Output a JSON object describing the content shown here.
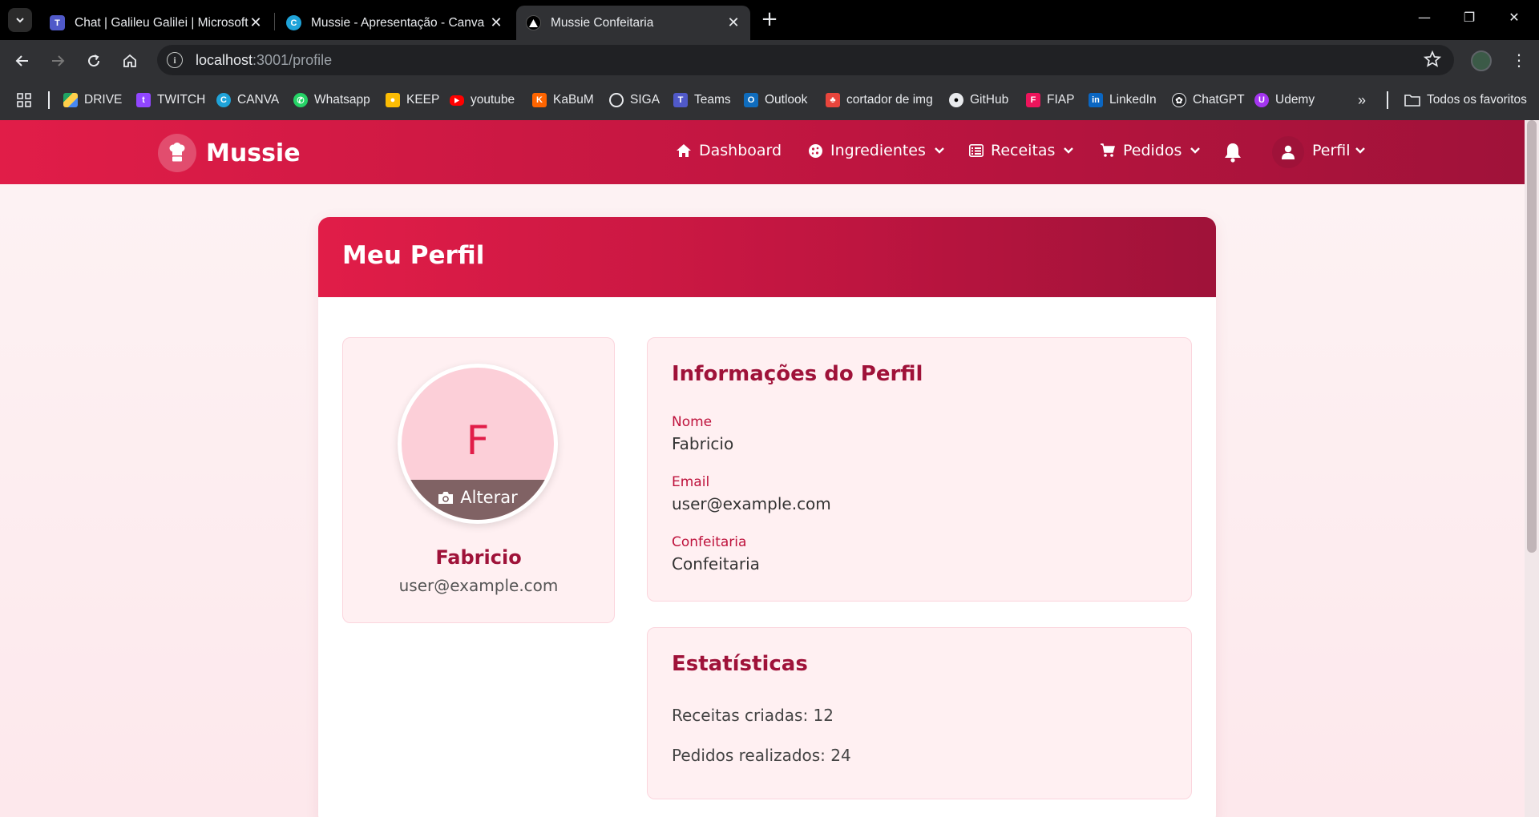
{
  "browser": {
    "tabs": [
      {
        "title": "Chat | Galileu Galilei | Microsoft Teams",
        "icon": "teams-icon"
      },
      {
        "title": "Mussie - Apresentação - Canva",
        "icon": "canva-icon"
      },
      {
        "title": "Mussie Confeitaria",
        "icon": "vercel-icon"
      }
    ],
    "url_host": "localhost",
    "url_path": ":3001/profile",
    "bookmarks": [
      "DRIVE",
      "TWITCH",
      "CANVA",
      "Whatsapp",
      "KEEP",
      "youtube",
      "KaBuM",
      "SIGA",
      "Teams",
      "Outlook",
      "cortador de img",
      "GitHub",
      "FIAP",
      "LinkedIn",
      "ChatGPT",
      "Udemy"
    ],
    "all_bookmarks": "Todos os favoritos"
  },
  "app": {
    "brand": "Mussie",
    "nav": {
      "dashboard": "Dashboard",
      "ingredientes": "Ingredientes",
      "receitas": "Receitas",
      "pedidos": "Pedidos",
      "perfil": "Perfil"
    }
  },
  "profile": {
    "page_title": "Meu Perfil",
    "avatar_initial": "F",
    "change_photo": "Alterar",
    "name": "Fabricio",
    "email": "user@example.com",
    "info_title": "Informações do Perfil",
    "fields": [
      {
        "label": "Nome",
        "value": "Fabricio"
      },
      {
        "label": "Email",
        "value": "user@example.com"
      },
      {
        "label": "Confeitaria",
        "value": "Confeitaria"
      }
    ],
    "stats_title": "Estatísticas",
    "stats": [
      "Receitas criadas: 12",
      "Pedidos realizados: 24"
    ]
  },
  "colors": {
    "primary": "#e11d48",
    "primary_dark": "#9f1239",
    "panel_bg": "#fff0f2"
  }
}
